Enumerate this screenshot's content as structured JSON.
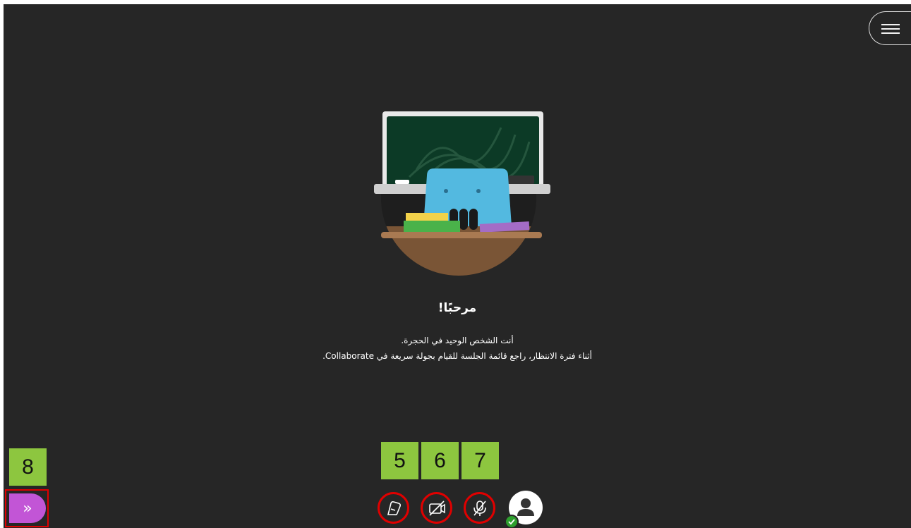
{
  "welcome": {
    "title": "مرحبًا!",
    "line1": "أنت الشخص الوحيد في الحجرة.",
    "line2": "أثناء فترة الانتظار، راجع قائمة الجلسة للقيام بجولة سريعة في Collaborate."
  },
  "annotations": {
    "a5": "5",
    "a6": "6",
    "a7": "7",
    "a8": "8"
  },
  "controls": {
    "share_content": "share-content-icon",
    "camera": "camera-off-icon",
    "microphone": "microphone-off-icon",
    "status_check": "check-icon"
  },
  "panel_toggle": {
    "glyph": "»"
  },
  "colors": {
    "background": "#262626",
    "alert_ring": "#e00000",
    "panel_toggle": "#c255d6",
    "annotation": "#8dc63f",
    "status_ok": "#2e9f2e"
  }
}
